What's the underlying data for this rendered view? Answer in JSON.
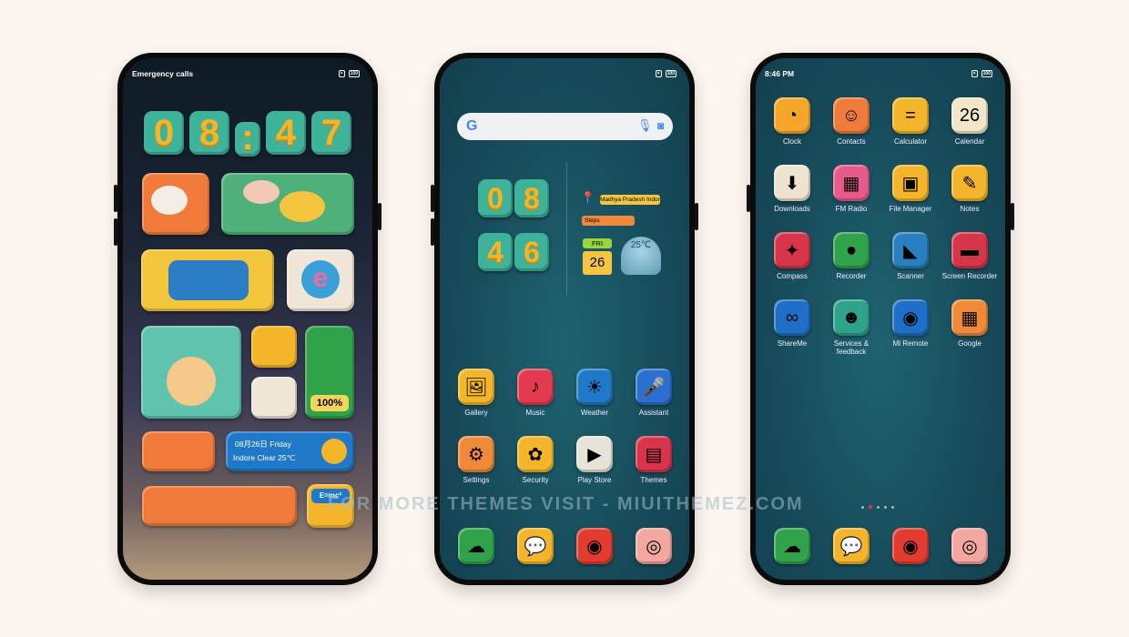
{
  "phone1": {
    "status_left": "Emergency calls",
    "battery": "100",
    "clock_digits": [
      "0",
      "8",
      ":",
      "4",
      "7"
    ],
    "weather_widget": {
      "date": "08月26日  Friday",
      "info": "Indore  Clear  25℃"
    },
    "battery_widget": "100%",
    "calc_widget": "E=mc²"
  },
  "phone2": {
    "battery": "100",
    "search_logo": "G",
    "clock_digits": [
      "0",
      "8",
      "4",
      "6"
    ],
    "location": "Madhya Pradesh Indore",
    "steps_label": "Steps",
    "day": "FRI",
    "date": "26",
    "temp": "25℃",
    "apps": [
      {
        "label": "Gallery",
        "icon": "gallery-icon",
        "glyph": "🖼",
        "color": "#f4b52b"
      },
      {
        "label": "Music",
        "icon": "music-icon",
        "glyph": "♪",
        "color": "#e23b4f"
      },
      {
        "label": "Weather",
        "icon": "weather-icon",
        "glyph": "☀",
        "color": "#1f78c8"
      },
      {
        "label": "Assistant",
        "icon": "assistant-icon",
        "glyph": "🎤",
        "color": "#2b6fd0"
      },
      {
        "label": "Settings",
        "icon": "settings-icon",
        "glyph": "⚙",
        "color": "#f08a3a"
      },
      {
        "label": "Security",
        "icon": "security-icon",
        "glyph": "✿",
        "color": "#f4b52b"
      },
      {
        "label": "Play Store",
        "icon": "play-store-icon",
        "glyph": "▶",
        "color": "#e8e3d8"
      },
      {
        "label": "Themes",
        "icon": "themes-icon",
        "glyph": "▤",
        "color": "#d8354a"
      }
    ],
    "dock": [
      {
        "icon": "phone-icon",
        "glyph": "☁",
        "color": "#2fa24a"
      },
      {
        "icon": "messages-icon",
        "glyph": "💬",
        "color": "#f4b52b"
      },
      {
        "icon": "chrome-icon",
        "glyph": "◉",
        "color": "#e23b2f"
      },
      {
        "icon": "camera-icon",
        "glyph": "◎",
        "color": "#f2a7a0"
      }
    ]
  },
  "phone3": {
    "time": "8:46 PM",
    "battery": "100",
    "apps": [
      {
        "label": "Clock",
        "icon": "clock-icon",
        "glyph": "◔",
        "color": "#f4a62b"
      },
      {
        "label": "Contacts",
        "icon": "contacts-icon",
        "glyph": "☺",
        "color": "#f07a3a"
      },
      {
        "label": "Calculator",
        "icon": "calculator-icon",
        "glyph": "=",
        "color": "#f4b52b"
      },
      {
        "label": "Calendar",
        "icon": "calendar-icon",
        "glyph": "26",
        "color": "#f1e6c8"
      },
      {
        "label": "Downloads",
        "icon": "downloads-icon",
        "glyph": "⬇",
        "color": "#eee3cf"
      },
      {
        "label": "FM Radio",
        "icon": "fm-radio-icon",
        "glyph": "▦",
        "color": "#e85a8a"
      },
      {
        "label": "File Manager",
        "icon": "file-manager-icon",
        "glyph": "▣",
        "color": "#f4b52b"
      },
      {
        "label": "Notes",
        "icon": "notes-icon",
        "glyph": "✎",
        "color": "#f4b52b"
      },
      {
        "label": "Compass",
        "icon": "compass-icon",
        "glyph": "✦",
        "color": "#d8354a"
      },
      {
        "label": "Recorder",
        "icon": "recorder-icon",
        "glyph": "●",
        "color": "#2fa24a"
      },
      {
        "label": "Scanner",
        "icon": "scanner-icon",
        "glyph": "◣",
        "color": "#2a7fc0"
      },
      {
        "label": "Screen Recorder",
        "icon": "screen-recorder-icon",
        "glyph": "▬",
        "color": "#d8354a"
      },
      {
        "label": "ShareMe",
        "icon": "shareme-icon",
        "glyph": "∞",
        "color": "#1f6fc8"
      },
      {
        "label": "Services & feedback",
        "icon": "services-feedback-icon",
        "glyph": "☻",
        "color": "#2fa28a"
      },
      {
        "label": "Mi Remote",
        "icon": "mi-remote-icon",
        "glyph": "◉",
        "color": "#1f6fc8"
      },
      {
        "label": "Google",
        "icon": "google-folder-icon",
        "glyph": "▦",
        "color": "#f08a3a"
      }
    ],
    "dock": [
      {
        "icon": "phone-icon",
        "glyph": "☁",
        "color": "#2fa24a"
      },
      {
        "icon": "messages-icon",
        "glyph": "💬",
        "color": "#f4b52b"
      },
      {
        "icon": "chrome-icon",
        "glyph": "◉",
        "color": "#e23b2f"
      },
      {
        "icon": "camera-icon",
        "glyph": "◎",
        "color": "#f2a7a0"
      }
    ]
  },
  "watermark": "FOR MORE THEMES VISIT - MIUITHEMEZ.COM"
}
